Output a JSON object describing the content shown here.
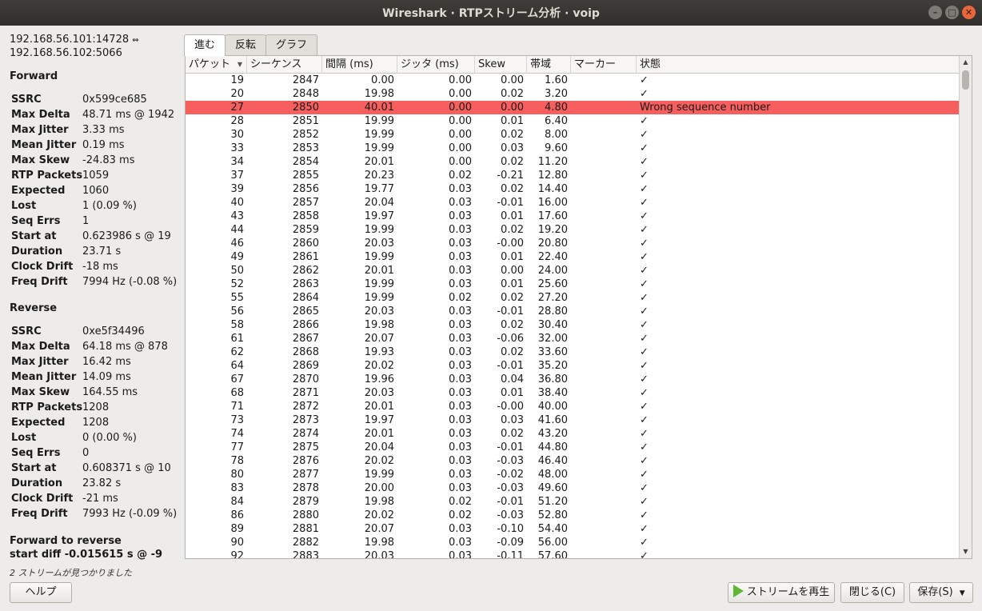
{
  "window": {
    "title": "Wireshark · RTPストリーム分析 · voip",
    "buttons": [
      "–",
      "□",
      "✕"
    ]
  },
  "stream": {
    "src": "192.168.56.101:14728",
    "swap_icon": "⇔",
    "dst": "192.168.56.102:5066"
  },
  "forward": {
    "title": "Forward",
    "stats": [
      {
        "k": "SSRC",
        "v": "0x599ce685"
      },
      {
        "k": "Max Delta",
        "v": "48.71 ms @ 1942"
      },
      {
        "k": "Max Jitter",
        "v": "3.33 ms"
      },
      {
        "k": "Mean Jitter",
        "v": "0.19 ms"
      },
      {
        "k": "Max Skew",
        "v": "-24.83 ms"
      },
      {
        "k": "RTP Packets",
        "v": "1059"
      },
      {
        "k": "Expected",
        "v": "1060"
      },
      {
        "k": "Lost",
        "v": "1 (0.09 %)"
      },
      {
        "k": "Seq Errs",
        "v": "1"
      },
      {
        "k": "Start at",
        "v": "0.623986 s @ 19"
      },
      {
        "k": "Duration",
        "v": "23.71 s"
      },
      {
        "k": "Clock Drift",
        "v": "-18 ms"
      },
      {
        "k": "Freq Drift",
        "v": "7994 Hz (-0.08 %)"
      }
    ]
  },
  "reverse": {
    "title": "Reverse",
    "stats": [
      {
        "k": "SSRC",
        "v": "0xe5f34496"
      },
      {
        "k": "Max Delta",
        "v": "64.18 ms @ 878"
      },
      {
        "k": "Max Jitter",
        "v": "16.42 ms"
      },
      {
        "k": "Mean Jitter",
        "v": "14.09 ms"
      },
      {
        "k": "Max Skew",
        "v": "164.55 ms"
      },
      {
        "k": "RTP Packets",
        "v": "1208"
      },
      {
        "k": "Expected",
        "v": "1208"
      },
      {
        "k": "Lost",
        "v": "0 (0.00 %)"
      },
      {
        "k": "Seq Errs",
        "v": "0"
      },
      {
        "k": "Start at",
        "v": "0.608371 s @ 10"
      },
      {
        "k": "Duration",
        "v": "23.82 s"
      },
      {
        "k": "Clock Drift",
        "v": "-21 ms"
      },
      {
        "k": "Freq Drift",
        "v": "7993 Hz (-0.09 %)"
      }
    ]
  },
  "f2r": {
    "line1": "Forward to reverse",
    "line2": "start diff -0.015615 s @ -9"
  },
  "found": "2 ストリームが見つかりました",
  "tabs": [
    "進む",
    "反転",
    "グラフ"
  ],
  "columns": [
    "パケット",
    "シーケンス",
    "間隔 (ms)",
    "ジッタ (ms)",
    "Skew",
    "帯域",
    "マーカー",
    "状態"
  ],
  "sort_icon": "▼",
  "rows": [
    [
      "19",
      "2847",
      "0.00",
      "0.00",
      "0.00",
      "1.60",
      "",
      "✓"
    ],
    [
      "20",
      "2848",
      "19.98",
      "0.00",
      "0.02",
      "3.20",
      "",
      "✓"
    ],
    [
      "27",
      "2850",
      "40.01",
      "0.00",
      "0.00",
      "4.80",
      "",
      "Wrong sequence number"
    ],
    [
      "28",
      "2851",
      "19.99",
      "0.00",
      "0.01",
      "6.40",
      "",
      "✓"
    ],
    [
      "30",
      "2852",
      "19.99",
      "0.00",
      "0.02",
      "8.00",
      "",
      "✓"
    ],
    [
      "33",
      "2853",
      "19.99",
      "0.00",
      "0.03",
      "9.60",
      "",
      "✓"
    ],
    [
      "34",
      "2854",
      "20.01",
      "0.00",
      "0.02",
      "11.20",
      "",
      "✓"
    ],
    [
      "37",
      "2855",
      "20.23",
      "0.02",
      "-0.21",
      "12.80",
      "",
      "✓"
    ],
    [
      "39",
      "2856",
      "19.77",
      "0.03",
      "0.02",
      "14.40",
      "",
      "✓"
    ],
    [
      "40",
      "2857",
      "20.04",
      "0.03",
      "-0.01",
      "16.00",
      "",
      "✓"
    ],
    [
      "43",
      "2858",
      "19.97",
      "0.03",
      "0.01",
      "17.60",
      "",
      "✓"
    ],
    [
      "44",
      "2859",
      "19.99",
      "0.03",
      "0.02",
      "19.20",
      "",
      "✓"
    ],
    [
      "46",
      "2860",
      "20.03",
      "0.03",
      "-0.00",
      "20.80",
      "",
      "✓"
    ],
    [
      "49",
      "2861",
      "19.99",
      "0.03",
      "0.01",
      "22.40",
      "",
      "✓"
    ],
    [
      "50",
      "2862",
      "20.01",
      "0.03",
      "0.00",
      "24.00",
      "",
      "✓"
    ],
    [
      "52",
      "2863",
      "19.99",
      "0.03",
      "0.01",
      "25.60",
      "",
      "✓"
    ],
    [
      "55",
      "2864",
      "19.99",
      "0.02",
      "0.02",
      "27.20",
      "",
      "✓"
    ],
    [
      "56",
      "2865",
      "20.03",
      "0.03",
      "-0.01",
      "28.80",
      "",
      "✓"
    ],
    [
      "58",
      "2866",
      "19.98",
      "0.03",
      "0.02",
      "30.40",
      "",
      "✓"
    ],
    [
      "61",
      "2867",
      "20.07",
      "0.03",
      "-0.06",
      "32.00",
      "",
      "✓"
    ],
    [
      "62",
      "2868",
      "19.93",
      "0.03",
      "0.02",
      "33.60",
      "",
      "✓"
    ],
    [
      "64",
      "2869",
      "20.02",
      "0.03",
      "-0.01",
      "35.20",
      "",
      "✓"
    ],
    [
      "67",
      "2870",
      "19.96",
      "0.03",
      "0.04",
      "36.80",
      "",
      "✓"
    ],
    [
      "68",
      "2871",
      "20.03",
      "0.03",
      "0.01",
      "38.40",
      "",
      "✓"
    ],
    [
      "71",
      "2872",
      "20.01",
      "0.03",
      "-0.00",
      "40.00",
      "",
      "✓"
    ],
    [
      "73",
      "2873",
      "19.97",
      "0.03",
      "0.03",
      "41.60",
      "",
      "✓"
    ],
    [
      "74",
      "2874",
      "20.01",
      "0.03",
      "0.02",
      "43.20",
      "",
      "✓"
    ],
    [
      "77",
      "2875",
      "20.04",
      "0.03",
      "-0.01",
      "44.80",
      "",
      "✓"
    ],
    [
      "78",
      "2876",
      "20.02",
      "0.03",
      "-0.03",
      "46.40",
      "",
      "✓"
    ],
    [
      "80",
      "2877",
      "19.99",
      "0.03",
      "-0.02",
      "48.00",
      "",
      "✓"
    ],
    [
      "83",
      "2878",
      "20.00",
      "0.03",
      "-0.03",
      "49.60",
      "",
      "✓"
    ],
    [
      "84",
      "2879",
      "19.98",
      "0.02",
      "-0.01",
      "51.20",
      "",
      "✓"
    ],
    [
      "86",
      "2880",
      "20.02",
      "0.02",
      "-0.03",
      "52.80",
      "",
      "✓"
    ],
    [
      "89",
      "2881",
      "20.07",
      "0.03",
      "-0.10",
      "54.40",
      "",
      "✓"
    ],
    [
      "90",
      "2882",
      "19.98",
      "0.03",
      "-0.09",
      "56.00",
      "",
      "✓"
    ],
    [
      "92",
      "2883",
      "20.03",
      "0.03",
      "-0.11",
      "57.60",
      "",
      "✓"
    ]
  ],
  "error_row_color": "#f75f5f",
  "buttons": {
    "help": "ヘルプ",
    "play": "ストリームを再生",
    "close": "閉じる(C)",
    "save": "保存(S)"
  }
}
